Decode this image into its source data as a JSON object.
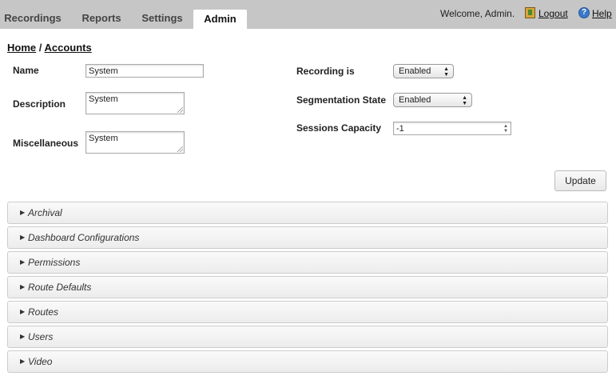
{
  "nav": {
    "tabs": [
      {
        "label": "Recordings",
        "active": false
      },
      {
        "label": "Reports",
        "active": false
      },
      {
        "label": "Settings",
        "active": false
      },
      {
        "label": "Admin",
        "active": true
      }
    ],
    "welcome": "Welcome, Admin.",
    "logout_label": "Logout",
    "help_label": "Help",
    "help_icon_glyph": "?"
  },
  "breadcrumb": {
    "home": "Home",
    "separator": "/",
    "current": "Accounts"
  },
  "form": {
    "name": {
      "label": "Name",
      "value": "System"
    },
    "description": {
      "label": "Description",
      "value": "System"
    },
    "miscellaneous": {
      "label": "Miscellaneous",
      "value": "System"
    },
    "recording": {
      "label": "Recording is",
      "value": "Enabled"
    },
    "segmentation": {
      "label": "Segmentation State",
      "value": "Enabled"
    },
    "sessions_capacity": {
      "label": "Sessions Capacity",
      "value": "-1"
    },
    "update_label": "Update"
  },
  "sections": [
    "Archival",
    "Dashboard Configurations",
    "Permissions",
    "Route Defaults",
    "Routes",
    "Users",
    "Video"
  ],
  "colors": {
    "topbar": "#c6c6c6",
    "active_tab": "#ffffff"
  }
}
